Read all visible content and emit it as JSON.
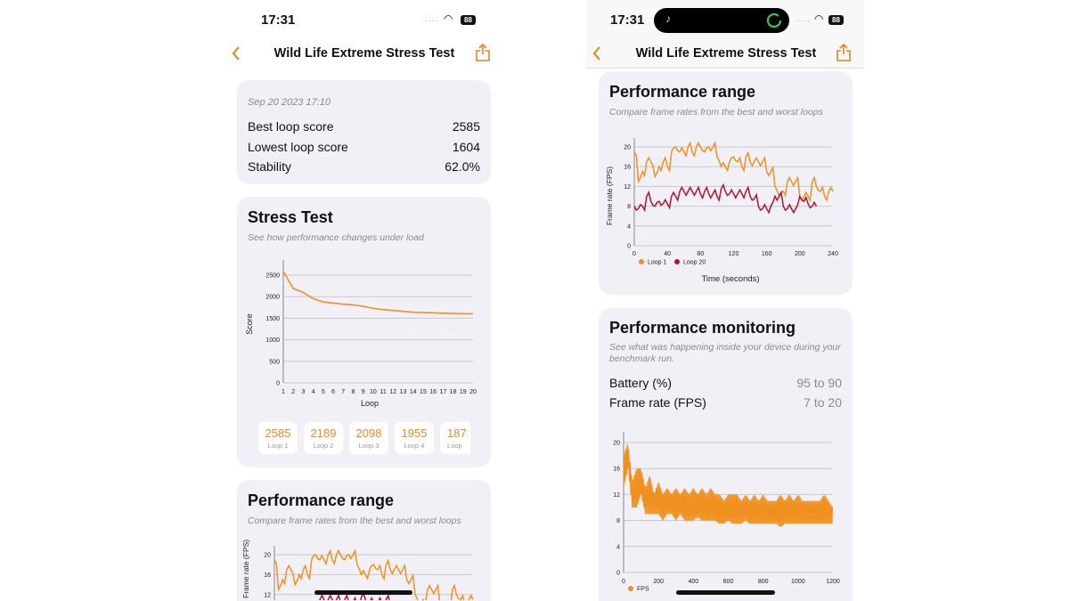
{
  "accent_color": "#e8821e",
  "loop1_color": "#f0901e",
  "loop20_color": "#b5122f",
  "left": {
    "status": {
      "time": "17:31",
      "battery": "88"
    },
    "nav": {
      "title": "Wild Life Extreme Stress Test",
      "back_icon": "chevron-left",
      "share_icon": "share"
    },
    "summary": {
      "date": "Sep 20 2023 17:10",
      "rows": [
        {
          "label": "Best loop score",
          "value": "2585"
        },
        {
          "label": "Lowest loop score",
          "value": "1604"
        },
        {
          "label": "Stability",
          "value": "62.0%"
        }
      ]
    },
    "stress": {
      "title": "Stress Test",
      "subtitle": "See how performance changes under load",
      "loops": [
        {
          "value": "2585",
          "label": "Loop 1"
        },
        {
          "value": "2189",
          "label": "Loop 2"
        },
        {
          "value": "2098",
          "label": "Loop 3"
        },
        {
          "value": "1955",
          "label": "Loop 4"
        },
        {
          "value": "187",
          "label": "Loop"
        }
      ]
    },
    "range": {
      "title": "Performance range",
      "subtitle": "Compare frame rates from the best and worst loops"
    }
  },
  "right": {
    "status": {
      "time": "17:31",
      "battery": "88"
    },
    "nav": {
      "title": "Wild Life Extreme Stress Test",
      "back_icon": "chevron-left",
      "share_icon": "share"
    },
    "range": {
      "title": "Performance range",
      "subtitle": "Compare frame rates from the best and worst loops"
    },
    "monitoring": {
      "title": "Performance monitoring",
      "subtitle": "See what was happening inside your device during your benchmark run.",
      "rows": [
        {
          "label": "Battery (%)",
          "value": "95 to 90"
        },
        {
          "label": "Frame rate (FPS)",
          "value": "7 to 20"
        }
      ]
    }
  },
  "chart_data": [
    {
      "type": "line",
      "xlabel": "Loop",
      "ylabel": "Score",
      "categories": [
        1,
        2,
        3,
        4,
        5,
        6,
        7,
        8,
        9,
        10,
        11,
        12,
        13,
        14,
        15,
        16,
        17,
        18,
        19,
        20
      ],
      "values": [
        2585,
        2189,
        2098,
        1955,
        1877,
        1850,
        1825,
        1810,
        1775,
        1730,
        1700,
        1680,
        1660,
        1640,
        1630,
        1625,
        1615,
        1610,
        1605,
        1604
      ],
      "ylim": [
        0,
        2500
      ],
      "yticks": [
        0,
        500,
        1000,
        1500,
        2000,
        2500
      ],
      "grid": true
    },
    {
      "type": "line",
      "xlabel": "Time (seconds)",
      "ylabel": "Frame rate (FPS)",
      "xlim": [
        0,
        240
      ],
      "xticks": [
        0,
        40,
        80,
        120,
        160,
        200,
        240
      ],
      "ylim": [
        0,
        20
      ],
      "yticks": [
        0,
        4,
        8,
        12,
        16,
        20
      ],
      "grid": true,
      "legend": "bottom-left",
      "x_step": 5,
      "series": [
        {
          "name": "Loop 1",
          "values": [
            19,
            13,
            15,
            17,
            17,
            14,
            16,
            17,
            16,
            19,
            20,
            19,
            19,
            20,
            19,
            20,
            20,
            19,
            20,
            20,
            18,
            16,
            16,
            17,
            18,
            17,
            16,
            18,
            17,
            17,
            17,
            17,
            15,
            15,
            12,
            10,
            11,
            13,
            13,
            13,
            10,
            10,
            10,
            13,
            12,
            11,
            10,
            11,
            11
          ]
        },
        {
          "name": "Loop 20",
          "values": [
            8,
            7.5,
            8,
            10,
            9,
            8,
            9,
            8.5,
            8.5,
            10,
            10,
            11,
            11,
            11,
            11,
            11,
            10.5,
            11,
            10.5,
            10.5,
            10,
            11.5,
            11,
            10.5,
            10.5,
            10.5,
            10.5,
            11,
            10,
            9.5,
            8,
            7.5,
            7.5,
            8,
            10,
            10,
            8,
            7.5,
            7.5,
            7.5,
            10,
            9,
            8.5,
            8,
            8
          ]
        }
      ]
    },
    {
      "type": "area",
      "legend": "bottom-left",
      "xlim": [
        0,
        1200
      ],
      "xticks": [
        0,
        200,
        400,
        600,
        800,
        1000,
        1200
      ],
      "ylim": [
        0,
        20
      ],
      "yticks": [
        0,
        4,
        8,
        12,
        16,
        20
      ],
      "grid": true,
      "x_step": 25,
      "series": [
        {
          "name": "FPS",
          "upper": [
            18,
            20,
            14,
            16,
            16,
            13,
            15,
            12,
            14,
            12,
            13,
            12,
            13,
            12,
            13,
            12,
            13,
            12,
            13,
            12,
            13,
            12,
            12,
            11,
            12,
            12,
            12,
            11,
            12,
            11,
            12,
            11,
            12,
            11,
            11,
            11,
            12,
            11,
            12,
            11,
            12,
            11,
            11,
            11,
            11,
            11,
            12,
            11,
            10
          ],
          "lower": [
            13,
            16,
            10,
            10,
            12,
            9,
            9,
            9,
            9,
            8,
            9,
            9,
            8,
            9,
            8,
            8,
            8,
            8.5,
            8,
            8,
            8,
            8,
            7.5,
            7.5,
            8,
            7.5,
            7.5,
            7.5,
            8,
            7.5,
            7.5,
            7.5,
            7.5,
            7.5,
            7.5,
            7.5,
            7,
            7.5,
            7.5,
            7.5,
            7.5,
            7.5,
            7.5,
            7.5,
            7.5,
            7.5,
            7.5,
            7.5,
            7.5
          ]
        }
      ]
    }
  ]
}
